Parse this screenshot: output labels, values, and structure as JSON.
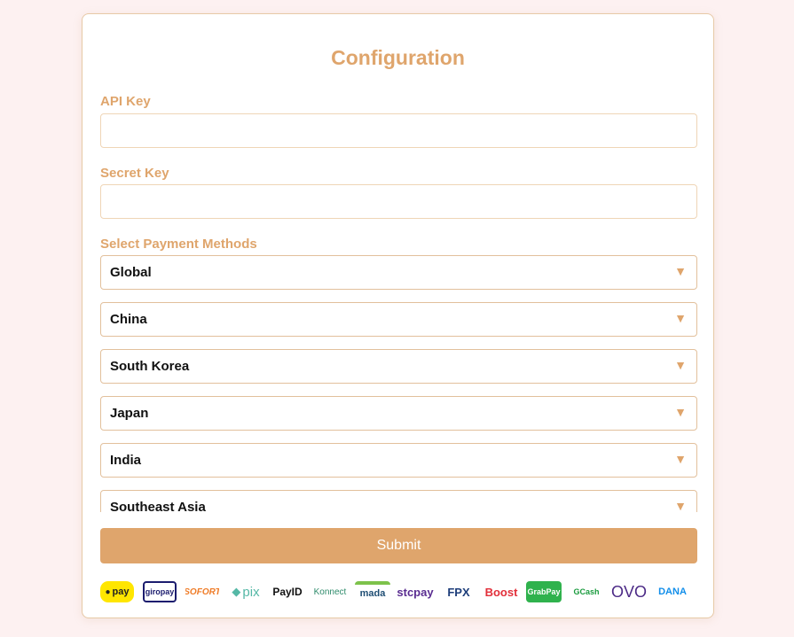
{
  "form": {
    "title": "Configuration",
    "api_key": {
      "label": "API Key",
      "value": "",
      "placeholder": ""
    },
    "secret_key": {
      "label": "Secret Key",
      "value": "",
      "placeholder": ""
    },
    "payment_methods_label": "Select Payment Methods",
    "regions": [
      "Global",
      "China",
      "South Korea",
      "Japan",
      "India",
      "Southeast Asia"
    ],
    "submit_label": "Submit"
  },
  "logos": [
    {
      "name": "kakaopay",
      "text": "pay"
    },
    {
      "name": "giropay",
      "text": "giropay"
    },
    {
      "name": "sofort",
      "text": "SOFORT"
    },
    {
      "name": "pix",
      "text": "pix"
    },
    {
      "name": "payid",
      "text": "PayID"
    },
    {
      "name": "konnect",
      "text": "Konnect"
    },
    {
      "name": "mada",
      "text": "mada"
    },
    {
      "name": "stcpay",
      "text": "stcpay"
    },
    {
      "name": "fpx",
      "text": "FPX"
    },
    {
      "name": "boost",
      "text": "Boost"
    },
    {
      "name": "grabpay",
      "text": "GrabPay"
    },
    {
      "name": "gcash",
      "text": "GCash"
    },
    {
      "name": "ovo",
      "text": "OVO"
    },
    {
      "name": "dana",
      "text": "DANA"
    }
  ],
  "colors": {
    "accent": "#dfa56c",
    "background": "#fdf1f1",
    "card_border": "#e7c9a6"
  }
}
